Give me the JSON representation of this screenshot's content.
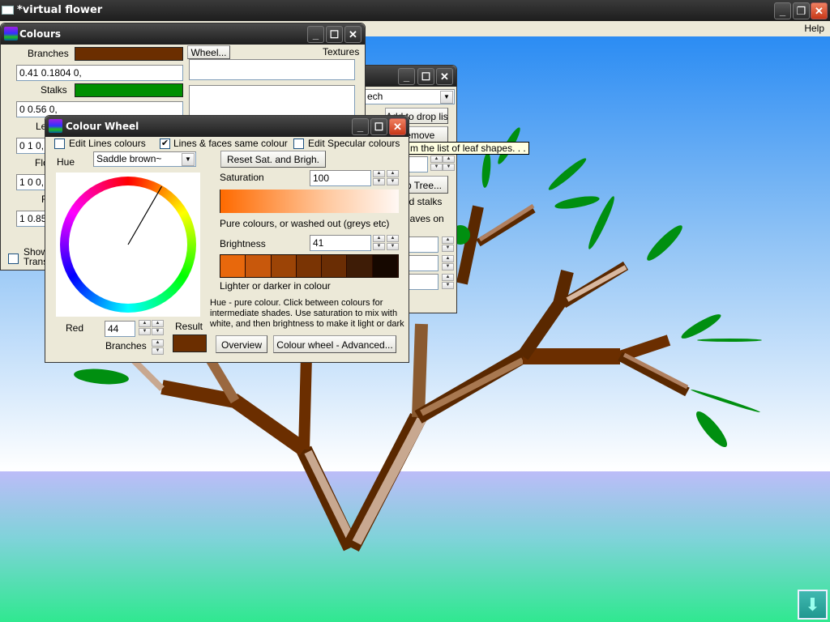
{
  "app": {
    "title": "*virtual flower",
    "menu": {
      "help": "Help"
    },
    "window_controls": {
      "minimize": "_",
      "restore": "❐",
      "close": "✕"
    }
  },
  "colours_window": {
    "title": "Colours",
    "branches_label": "Branches",
    "branches_color": "#6b2e00",
    "branches_value": "0.41 0.1804 0,",
    "stalks_label": "Stalks",
    "stalks_color": "#008f00",
    "stalks_value": "0 0.56 0,",
    "leaves_label": "Le",
    "leaves_value": "0 1 0,",
    "flowers_label": "Flo",
    "flowers_value": "1 0 0,",
    "fourth_label": "F",
    "fourth_value": "1 0.85",
    "wheel_button": "Wheel...",
    "textures_label": "Textures",
    "show_transparent_label_1": "Show",
    "show_transparent_label_2": "Trans",
    "show_transparent_checked": false
  },
  "leaf_window": {
    "combo_value": "ech",
    "add_to_drop_list": "Add to drop list",
    "remove": "Remove",
    "tree_button": "p Tree...",
    "add_stalks": "dd stalks",
    "leaves_on": "eaves on"
  },
  "tooltip": {
    "text": "m the list of leaf shapes. . ."
  },
  "colour_wheel_window": {
    "title": "Colour Wheel",
    "edit_lines_colours": {
      "label": "Edit Lines colours",
      "checked": false
    },
    "lines_faces_same": {
      "label": "Lines & faces same colour",
      "checked": true
    },
    "edit_specular": {
      "label": "Edit Specular colours",
      "checked": false
    },
    "hue_label": "Hue",
    "hue_value": "Saddle brown~",
    "reset_button": "Reset Sat. and Brigh.",
    "saturation_label": "Saturation",
    "saturation_value": "100",
    "saturation_hint": "Pure colours, or washed out (greys etc)",
    "brightness_label": "Brightness",
    "brightness_value": "41",
    "brightness_hint": "Lighter or darker in colour",
    "brightness_swatches": [
      "#e8680c",
      "#c8580c",
      "#9c4406",
      "#7a3404",
      "#6a2d04",
      "#3e1c06",
      "#160800"
    ],
    "hue_angle_deg": 30,
    "help_text": "Hue - pure colour. Click between colours for intermediate shades. Use saturation to mix with white, and then brightness to make it light or dark",
    "channel_label": "Red",
    "channel_value": "44",
    "target_label": "Branches",
    "result_label": "Result",
    "result_color": "#6b2e00",
    "overview_button": "Overview",
    "advanced_button": "Colour wheel - Advanced..."
  }
}
